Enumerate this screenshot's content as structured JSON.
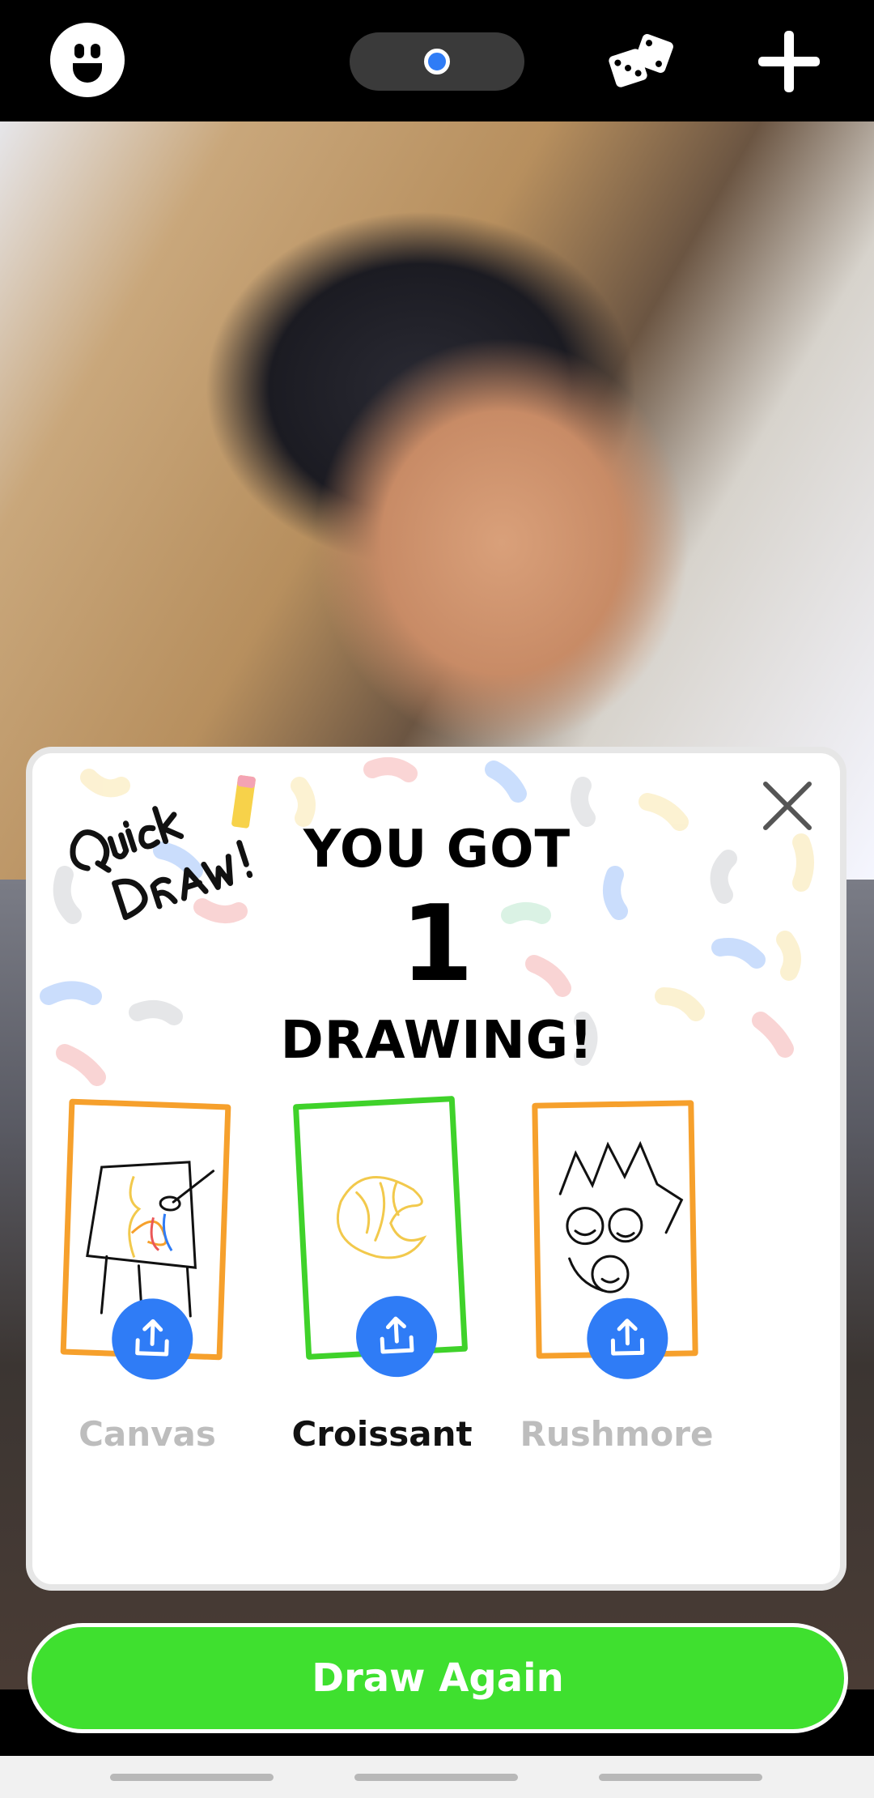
{
  "result": {
    "line1": "YOU GOT",
    "count": "1",
    "line2": "DRAWING!"
  },
  "drawings": [
    {
      "label": "Canvas",
      "state": "dim"
    },
    {
      "label": "Croissant",
      "state": "active"
    },
    {
      "label": "Rushmore",
      "state": "dim"
    }
  ],
  "footer": {
    "draw_again_label": "Draw Again"
  },
  "logo": {
    "text": "Quick Draw!"
  },
  "colors": {
    "primary_green": "#3fe02f",
    "share_blue": "#2f7cf6",
    "orange": "#f6a02c",
    "green_border": "#3fd22a"
  },
  "icons": [
    "smiley-icon",
    "record-dot-icon",
    "dice-icon",
    "plus-icon",
    "close-icon",
    "share-icon"
  ]
}
